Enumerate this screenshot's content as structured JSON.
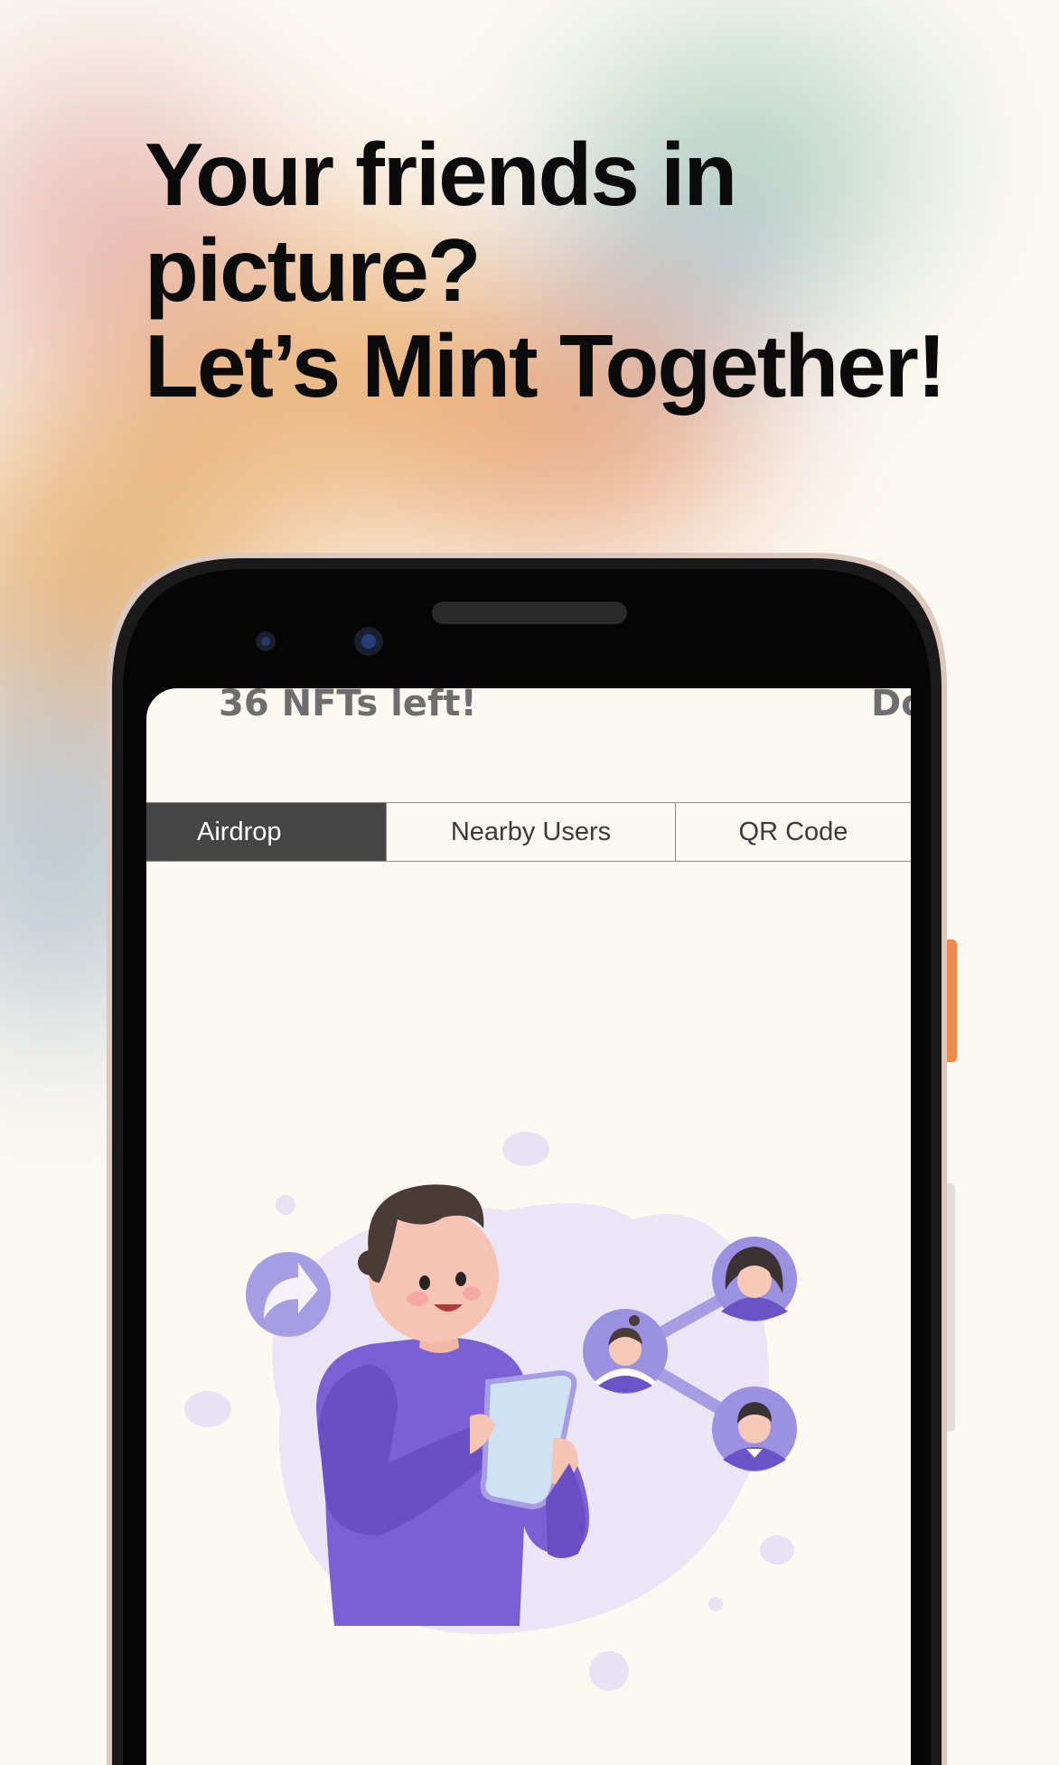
{
  "headline": {
    "line1": "Your friends in",
    "line2": "picture?",
    "line3": "Let’s Mint Together!"
  },
  "screen": {
    "nft_counter": "36 NFTs left!",
    "right_label_fragment": "Do",
    "tabs": [
      {
        "label": "Airdrop",
        "active": true
      },
      {
        "label": "Nearby Users",
        "active": false
      },
      {
        "label": "QR Code",
        "active": false
      }
    ],
    "illustration": "person-sharing-with-friends-icon"
  },
  "colors": {
    "background": "#fcf9f3",
    "headline": "#0b0b0b",
    "tab_active_bg": "#454545",
    "accent_purple": "#7b5fd4",
    "phone_button_orange": "#f08a4b"
  }
}
